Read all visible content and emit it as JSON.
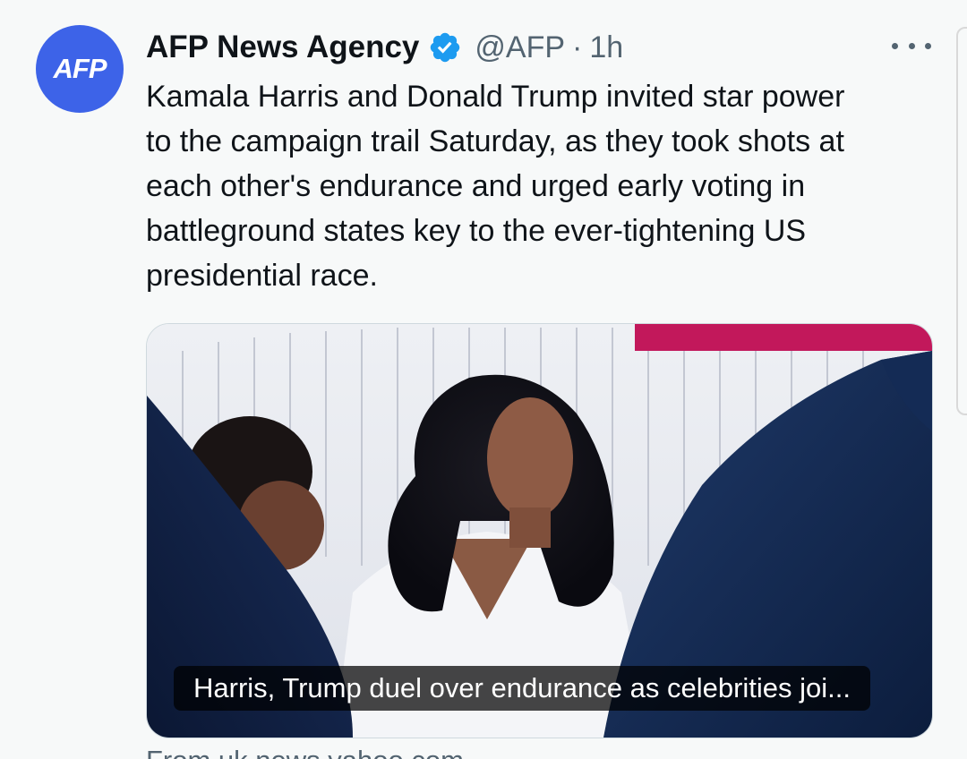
{
  "author": {
    "avatar_text": "AFP",
    "display_name": "AFP News Agency",
    "handle": "@AFP",
    "separator": "·",
    "timestamp": "1h"
  },
  "tweet": {
    "text": "Kamala Harris and Donald Trump invited star power\nto the campaign trail Saturday, as they took shots at\neach other's endurance and urged early voting in\nbattleground states key to the ever-tightening US\npresidential race."
  },
  "link_card": {
    "caption": "Harris, Trump duel over endurance as celebrities joi...",
    "source": "From uk.news.yahoo.com"
  },
  "icons": {
    "verified": "verified-badge-icon",
    "more": "more-options-icon"
  },
  "colors": {
    "accent": "#1d9bf0",
    "avatar_bg": "#3d63e8",
    "secondary_text": "#536471"
  }
}
